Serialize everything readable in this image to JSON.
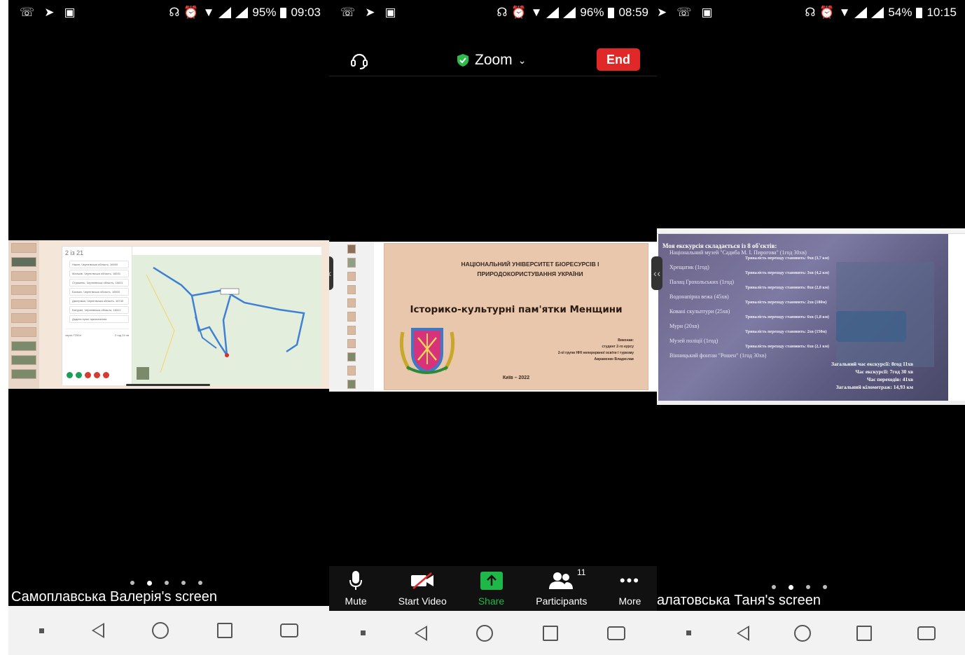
{
  "panel1": {
    "status": {
      "battery": "95%",
      "time": "09:03"
    },
    "map": {
      "tab_label": "2 із 21",
      "places": [
        "Ніжин, Чернігівська область, 16600",
        "Мальків, Чернігівська область, 16631",
        "Стрижень, Чернігівська область, 16611",
        "Бахмач, Чернігівська область, 16500",
        "Дмитрівка, Чернігівська область, 16740",
        "Батурин, Чернігівська область, 16512",
        "Додати пункт призначення"
      ],
      "route_time": "2 год 24 хв",
      "route_label": "через Т2504"
    },
    "page_dots": 5,
    "active_dot": 1,
    "caption": "Самоплавська Валерія's screen"
  },
  "panel2": {
    "status": {
      "battery": "96%",
      "time": "08:59"
    },
    "topbar": {
      "title": "Zoom",
      "end_label": "End"
    },
    "slide": {
      "university": "НАЦІОНАЛЬНИЙ УНІВЕРСИТЕТ БІОРЕСУРСІВ І ПРИРОДОКОРИСТУВАННЯ УКРАЇНИ",
      "title": "Історико-культурні пам'ятки Менщини",
      "performer_label": "Виконав:",
      "performer_lines": [
        "студент 2-го курсу",
        "2-ої групи ННІ неперервної освіти і туризму",
        "Авраменко Владислав"
      ],
      "footer": "Київ – 2022"
    },
    "toolbar": {
      "mute": "Mute",
      "video": "Start Video",
      "share": "Share",
      "participants": "Participants",
      "participants_count": "11",
      "more": "More"
    },
    "colors": {
      "end": "#e02828",
      "share": "#1db847",
      "shield": "#2dbb4b"
    }
  },
  "panel3": {
    "status": {
      "battery": "54%",
      "time": "10:15"
    },
    "slide": {
      "heading": "Моя екскурсія складається із 8 об'єктів:",
      "items": [
        "Національний музей \"Садиба М. І. Пирогова\" (1год 30хв)",
        "Хрещатик (1год)",
        "Палац Грохольських (1год)",
        "Водонапірна вежа (45хв)",
        "Ковані скульптури (25хв)",
        "Мури (20хв)",
        "Музей поліції (1год)",
        "Вінницький фонтан \"Рошен\" (1год 30хв)"
      ],
      "transitions": [
        "Тривалість переходу становить: 9хв (3,7 км)",
        "Тривалість переходу становить: 3хв (4,2 км)",
        "Тривалість переходу становить: 8хв (2,8 км)",
        "Тривалість переходу становить: 2хв (180м)",
        "Тривалість переходу становить: 6хв (1,8 км)",
        "Тривалість переходу становить: 2хв (150м)",
        "Тривалість переходу становить: 6хв (2,1 км)"
      ],
      "summary": [
        "Загальний час екскурсії: 8год 11хв",
        "Час екскурсії: 7год 30 хв",
        "Час переходів: 41хв",
        "Загальний кілометраж: 14,93 км"
      ]
    },
    "page_dots": 4,
    "active_dot": 1,
    "caption": "алатовська Таня's screen"
  }
}
